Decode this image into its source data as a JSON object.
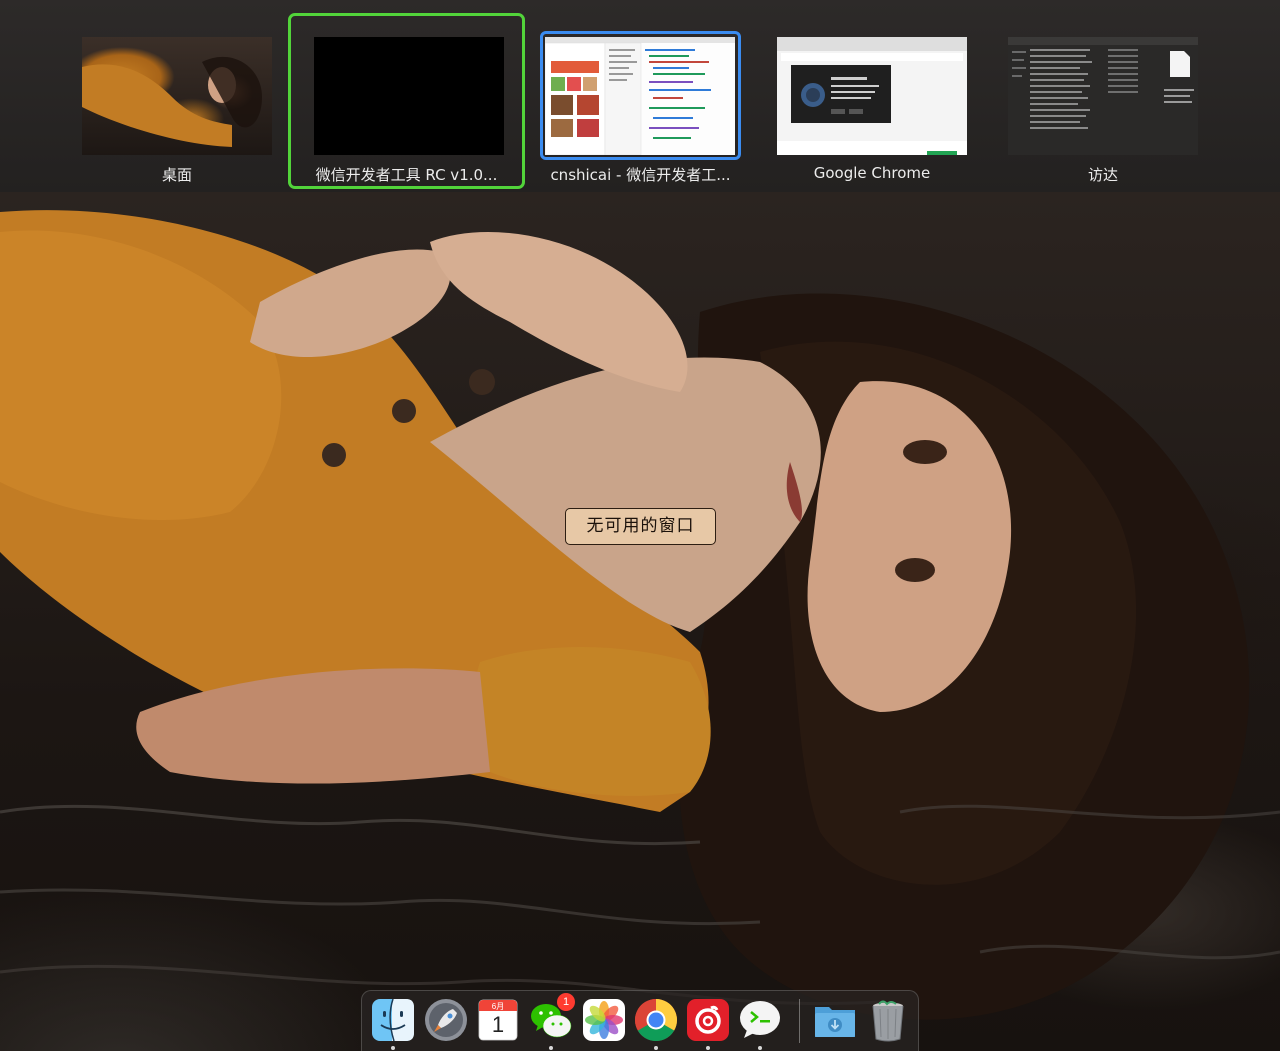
{
  "spaces": [
    {
      "label": "桌面",
      "kind": "desktop"
    },
    {
      "label": "微信开发者工具 RC v1.0...",
      "kind": "black",
      "selected": true
    },
    {
      "label": "cnshicai - 微信开发者工...",
      "kind": "editor",
      "active": true
    },
    {
      "label": "Google Chrome",
      "kind": "chrome"
    },
    {
      "label": "访达",
      "kind": "finder"
    }
  ],
  "center_message": "无可用的窗口",
  "dock": {
    "items": [
      {
        "name": "finder",
        "icon": "finder-icon",
        "running": true
      },
      {
        "name": "launchpad",
        "icon": "rocket-icon",
        "running": false
      },
      {
        "name": "calendar",
        "icon": "calendar-icon",
        "running": false,
        "month": "6月",
        "day": "1"
      },
      {
        "name": "wechat",
        "icon": "wechat-icon",
        "running": true,
        "badge": "1"
      },
      {
        "name": "photos",
        "icon": "photos-icon",
        "running": false
      },
      {
        "name": "chrome",
        "icon": "chrome-icon",
        "running": true
      },
      {
        "name": "netease-music",
        "icon": "netease-music-icon",
        "running": true
      },
      {
        "name": "wechat-devtools",
        "icon": "terminal-bubble-icon",
        "running": true
      },
      {
        "name": "downloads",
        "icon": "downloads-folder-icon",
        "running": false
      },
      {
        "name": "trash",
        "icon": "trash-icon",
        "running": false
      }
    ]
  },
  "colors": {
    "selected_border": "#52d43a",
    "active_border": "#3b8cf0",
    "popup_bg": "#e7c8a6",
    "badge": "#ff3b30"
  }
}
